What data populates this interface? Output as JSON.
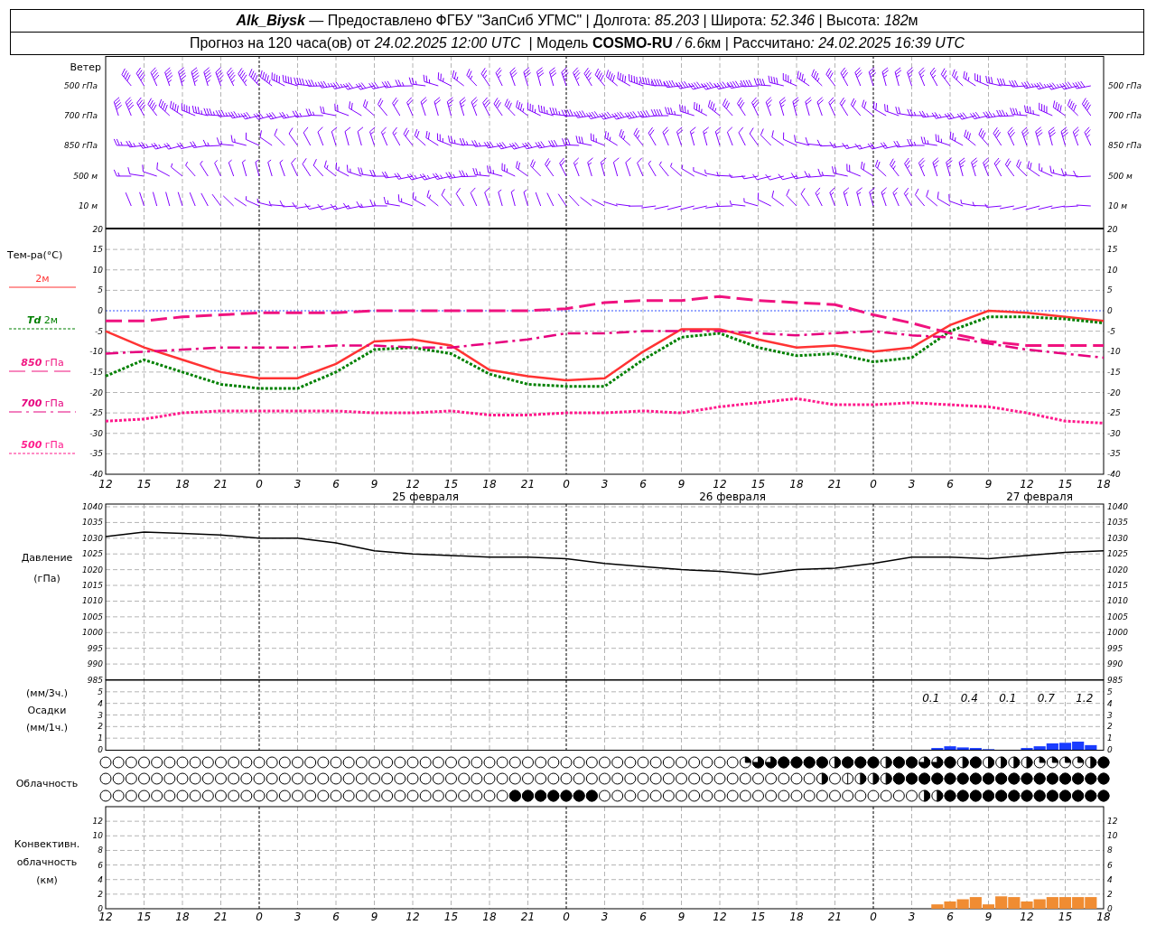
{
  "header": {
    "line1": [
      {
        "text": "Alk_Biysk",
        "kind": "station"
      },
      {
        "text": " — Предоставлено ФГБУ \"ЗапСиб УГМС\" | Долгота: ",
        "kind": "caption"
      },
      {
        "text": "85.203",
        "kind": "value"
      },
      {
        "text": " | Широта: ",
        "kind": "caption"
      },
      {
        "text": "52.346",
        "kind": "value"
      },
      {
        "text": " | Высота: ",
        "kind": "caption"
      },
      {
        "text": "182",
        "kind": "value"
      },
      {
        "text": "м",
        "kind": "caption"
      }
    ],
    "line2": [
      {
        "text": "Прогноз на 120 часа(ов) от ",
        "kind": "caption"
      },
      {
        "text": "24.02.2025 12:00 UTC",
        "kind": "value"
      },
      {
        "text": "  | Модель ",
        "kind": "caption"
      },
      {
        "text": "COSMO-RU",
        "kind": "model"
      },
      {
        "text": " / 6.6",
        "kind": "value"
      },
      {
        "text": "км | Рассчитано",
        "kind": "caption"
      },
      {
        "text": ": 24.02.2025 16:39 UTC",
        "kind": "value"
      }
    ]
  },
  "wind": {
    "title": "Ветер",
    "labels_left": [
      "500 гПа",
      "700 гПа",
      "850 гПа",
      "500 м",
      "10 м"
    ],
    "labels_right": [
      "500 гПа",
      "700 гПа",
      "850 гПа",
      "500 м",
      "10 м"
    ]
  },
  "temperature": {
    "title": "Тем-ра(°C)",
    "dates": [
      "25 февраля",
      "26 февраля",
      "27 февраля"
    ],
    "right_ticks": [
      "20",
      "15",
      "10",
      "5",
      "0",
      "-5",
      "-10",
      "-15",
      "-20",
      "-25",
      "-30",
      "-35",
      "-40"
    ],
    "chart_data": {
      "type": "line",
      "grid": true,
      "categories": [
        "12",
        "15",
        "18",
        "21",
        "0",
        "3",
        "6",
        "9",
        "12",
        "15",
        "18",
        "21",
        "0",
        "3",
        "6",
        "9",
        "12",
        "15",
        "18",
        "21",
        "0",
        "3",
        "6",
        "9",
        "12",
        "15",
        "18"
      ],
      "ylim": [
        -40,
        20
      ],
      "yticks": [
        {
          "value": 20,
          "label": "20"
        },
        {
          "value": 15,
          "label": "15"
        },
        {
          "value": 10,
          "label": "10"
        },
        {
          "value": 5,
          "label": "5"
        },
        {
          "value": 0,
          "label": "0"
        },
        {
          "value": -5,
          "label": "-5"
        },
        {
          "value": -10,
          "label": "-10"
        },
        {
          "value": -15,
          "label": "-15"
        },
        {
          "value": -20,
          "label": "-20"
        },
        {
          "value": -25,
          "label": "-25"
        },
        {
          "value": -30,
          "label": "-30"
        },
        {
          "value": -35,
          "label": "-35"
        },
        {
          "value": -40,
          "label": "-40"
        }
      ],
      "series": [
        {
          "name": "2м",
          "color": "#ff3333",
          "line_style": "solid",
          "values": [
            -5,
            -9,
            -12,
            -15,
            -16.5,
            -16.5,
            -13,
            -7.5,
            -7,
            -8.5,
            -14.5,
            -16,
            -17,
            -16.5,
            -10,
            -4.5,
            -4.5,
            -7,
            -9,
            -8.5,
            -10,
            -9,
            -3.5,
            0,
            -0.5,
            -1.5,
            -2.5
          ]
        },
        {
          "name": "*Td* 2м",
          "color": "#008000",
          "line_style": "dotted",
          "values": [
            -16,
            -12,
            -15,
            -18,
            -19,
            -19,
            -15,
            -9.5,
            -9,
            -10.5,
            -15.5,
            -18,
            -18.5,
            -18.5,
            -12,
            -6.5,
            -5.5,
            -9,
            -11,
            -10.5,
            -12.5,
            -11.5,
            -5,
            -1.5,
            -1.5,
            -2,
            -3
          ]
        },
        {
          "name": "*850* гПа",
          "color": "#f0127f",
          "line_style": "dashed",
          "values": [
            -2.5,
            -2.5,
            -1.5,
            -1,
            -0.5,
            -0.5,
            -0.5,
            0,
            0,
            0,
            0,
            0,
            0.5,
            2,
            2.5,
            2.5,
            3.5,
            2.5,
            2,
            1.5,
            -1,
            -3,
            -5.5,
            -7.5,
            -8.5,
            -8.5,
            -8.5
          ]
        },
        {
          "name": "*700* гПа",
          "color": "#e6007e",
          "line_style": "dashdot",
          "values": [
            -10.5,
            -10,
            -9.5,
            -9,
            -9,
            -9,
            -8.5,
            -8.5,
            -9,
            -9,
            -8,
            -7,
            -5.5,
            -5.5,
            -5,
            -5,
            -5,
            -5.5,
            -6,
            -5.5,
            -5,
            -6,
            -6.5,
            -8,
            -9.5,
            -10.5,
            -11.5
          ]
        },
        {
          "name": "*500* гПа",
          "color": "#ff1a8c",
          "line_style": "dotted",
          "values": [
            -27,
            -26.5,
            -25,
            -24.5,
            -24.5,
            -24.5,
            -24.5,
            -25,
            -25,
            -24.5,
            -25.5,
            -25.5,
            -25,
            -25,
            -24.5,
            -25,
            -23.5,
            -22.5,
            -21.5,
            -23,
            -23,
            -22.5,
            -23,
            -23.5,
            -25,
            -27,
            -27.5
          ]
        }
      ],
      "ref_lines": [
        {
          "axis": "y",
          "value": 0,
          "color": "#3050ff"
        }
      ]
    }
  },
  "pressure": {
    "labels": [
      "Давление",
      "(гПа)"
    ],
    "right_ticks": [
      "1040",
      "1035",
      "1030",
      "1025",
      "1020",
      "1015",
      "1010",
      "1005",
      "1000",
      "995",
      "990",
      "985"
    ],
    "chart_data": {
      "type": "line",
      "grid": true,
      "categories": [
        null,
        null,
        null,
        null,
        null,
        null,
        null,
        null,
        null,
        null,
        null,
        null,
        null,
        null,
        null,
        null,
        null,
        null,
        null,
        null,
        null,
        null,
        null,
        null,
        null,
        null,
        null
      ],
      "ylim": [
        985,
        1040
      ],
      "yticks": [
        {
          "value": 1040,
          "label": "1040"
        },
        {
          "value": 1035,
          "label": "1035"
        },
        {
          "value": 1030,
          "label": "1030"
        },
        {
          "value": 1025,
          "label": "1025"
        },
        {
          "value": 1020,
          "label": "1020"
        },
        {
          "value": 1015,
          "label": "1015"
        },
        {
          "value": 1010,
          "label": "1010"
        },
        {
          "value": 1005,
          "label": "1005"
        },
        {
          "value": 1000,
          "label": "1000"
        },
        {
          "value": 995,
          "label": "995"
        },
        {
          "value": 990,
          "label": "990"
        },
        {
          "value": 985,
          "label": "985"
        }
      ],
      "series": [
        {
          "color": "#000000",
          "values": [
            1030.5,
            1032,
            1031.5,
            1031,
            1030,
            1030,
            1028.5,
            1026,
            1025,
            1024.5,
            1024,
            1024,
            1023.5,
            1022,
            1021,
            1020,
            1019.5,
            1018.5,
            1020,
            1020.5,
            1022,
            1024,
            1024,
            1023.5,
            1024.5,
            1025.5,
            1026
          ]
        }
      ]
    }
  },
  "precipitation": {
    "labels": [
      "(мм/3ч.)",
      "Осадки",
      "(мм/1ч.)"
    ],
    "totals": [
      "0.1",
      "0.4",
      "0.1",
      "0.7",
      "1.2"
    ],
    "right_ticks": [
      "5",
      "4",
      "3",
      "2",
      "1",
      "0"
    ],
    "chart_data": {
      "type": "bar",
      "grid": true,
      "categories": [
        null,
        null,
        null,
        null,
        null,
        null,
        null,
        null,
        null,
        null,
        null,
        null,
        null,
        null,
        null,
        null,
        null,
        null,
        null,
        null,
        null,
        null,
        null,
        null,
        null,
        null,
        null,
        null,
        null,
        null,
        null,
        null,
        null,
        null,
        null,
        null,
        null,
        null,
        null,
        null,
        null,
        null,
        null,
        null,
        null,
        null,
        null,
        null,
        null,
        null,
        null,
        null,
        null,
        null,
        null,
        null,
        null,
        null,
        null,
        null,
        null,
        null,
        null,
        null,
        null,
        null,
        null,
        null,
        null,
        null,
        null,
        null,
        null,
        null,
        null,
        null,
        null,
        null,
        null
      ],
      "series": [
        {
          "color": "#1a3cff",
          "values": [
            null,
            null,
            null,
            null,
            null,
            null,
            null,
            null,
            null,
            null,
            null,
            null,
            null,
            null,
            null,
            null,
            null,
            null,
            null,
            null,
            null,
            null,
            null,
            null,
            null,
            null,
            null,
            null,
            null,
            null,
            null,
            null,
            null,
            null,
            null,
            null,
            null,
            null,
            null,
            null,
            null,
            null,
            null,
            null,
            null,
            null,
            null,
            null,
            null,
            null,
            null,
            null,
            null,
            null,
            null,
            null,
            null,
            null,
            null,
            null,
            null,
            null,
            null,
            null,
            null,
            0.15,
            0.3,
            0.2,
            0.15,
            0.05,
            0,
            0,
            0.15,
            0.3,
            0.55,
            0.6,
            0.7,
            0.4,
            null
          ]
        }
      ],
      "ylim": [
        0,
        6
      ],
      "yticks": [
        {
          "value": 5,
          "label": "5"
        },
        {
          "value": 4,
          "label": "4"
        },
        {
          "value": 3,
          "label": "3"
        },
        {
          "value": 2,
          "label": "2"
        },
        {
          "value": 1,
          "label": "1"
        },
        {
          "value": 0,
          "label": "0"
        }
      ]
    }
  },
  "clouds": {
    "label": "Облачность",
    "rows": [
      {
        "circles": [
          {
            "kind": "clear"
          },
          {
            "kind": "clear"
          },
          {
            "kind": "clear"
          },
          {
            "kind": "clear"
          },
          {
            "kind": "clear"
          },
          {
            "kind": "clear"
          },
          {
            "kind": "clear"
          },
          {
            "kind": "clear"
          },
          {
            "kind": "clear"
          },
          {
            "kind": "clear"
          },
          {
            "kind": "clear"
          },
          {
            "kind": "clear"
          },
          {
            "kind": "clear"
          },
          {
            "kind": "clear"
          },
          {
            "kind": "clear"
          },
          {
            "kind": "clear"
          },
          {
            "kind": "clear"
          },
          {
            "kind": "clear"
          },
          {
            "kind": "clear"
          },
          {
            "kind": "clear"
          },
          {
            "kind": "clear"
          },
          {
            "kind": "clear"
          },
          {
            "kind": "clear"
          },
          {
            "kind": "clear"
          },
          {
            "kind": "clear"
          },
          {
            "kind": "clear"
          },
          {
            "kind": "clear"
          },
          {
            "kind": "clear"
          },
          {
            "kind": "clear"
          },
          {
            "kind": "clear"
          },
          {
            "kind": "clear"
          },
          {
            "kind": "clear"
          },
          {
            "kind": "clear"
          },
          {
            "kind": "clear"
          },
          {
            "kind": "clear"
          },
          {
            "kind": "clear"
          },
          {
            "kind": "clear"
          },
          {
            "kind": "clear"
          },
          {
            "kind": "clear"
          },
          {
            "kind": "clear"
          },
          {
            "kind": "clear"
          },
          {
            "kind": "clear"
          },
          {
            "kind": "clear"
          },
          {
            "kind": "clear"
          },
          {
            "kind": "clear"
          },
          {
            "kind": "clear"
          },
          {
            "kind": "clear"
          },
          {
            "kind": "clear"
          },
          {
            "kind": "clear"
          },
          {
            "kind": "clear"
          },
          {
            "kind": "quarter"
          },
          {
            "kind": "three_quarters"
          },
          {
            "kind": "three_quarters"
          },
          {
            "kind": "overcast"
          },
          {
            "kind": "overcast"
          },
          {
            "kind": "overcast"
          },
          {
            "kind": "overcast"
          },
          {
            "kind": "half"
          },
          {
            "kind": "overcast"
          },
          {
            "kind": "overcast"
          },
          {
            "kind": "overcast"
          },
          {
            "kind": "half"
          },
          {
            "kind": "overcast"
          },
          {
            "kind": "overcast"
          },
          {
            "kind": "three_quarters"
          },
          {
            "kind": "three_quarters"
          },
          {
            "kind": "overcast"
          },
          {
            "kind": "half"
          },
          {
            "kind": "overcast"
          },
          {
            "kind": "half"
          },
          {
            "kind": "half"
          },
          {
            "kind": "half"
          },
          {
            "kind": "half"
          },
          {
            "kind": "quarter"
          },
          {
            "kind": "quarter"
          },
          {
            "kind": "quarter"
          },
          {
            "kind": "quarter"
          },
          {
            "kind": "half"
          },
          {
            "kind": "overcast"
          }
        ]
      },
      {
        "circles": [
          {
            "kind": "clear"
          },
          {
            "kind": "clear"
          },
          {
            "kind": "clear"
          },
          {
            "kind": "clear"
          },
          {
            "kind": "clear"
          },
          {
            "kind": "clear"
          },
          {
            "kind": "clear"
          },
          {
            "kind": "clear"
          },
          {
            "kind": "clear"
          },
          {
            "kind": "clear"
          },
          {
            "kind": "clear"
          },
          {
            "kind": "clear"
          },
          {
            "kind": "clear"
          },
          {
            "kind": "clear"
          },
          {
            "kind": "clear"
          },
          {
            "kind": "clear"
          },
          {
            "kind": "clear"
          },
          {
            "kind": "clear"
          },
          {
            "kind": "clear"
          },
          {
            "kind": "clear"
          },
          {
            "kind": "clear"
          },
          {
            "kind": "clear"
          },
          {
            "kind": "clear"
          },
          {
            "kind": "clear"
          },
          {
            "kind": "clear"
          },
          {
            "kind": "clear"
          },
          {
            "kind": "clear"
          },
          {
            "kind": "clear"
          },
          {
            "kind": "clear"
          },
          {
            "kind": "clear"
          },
          {
            "kind": "clear"
          },
          {
            "kind": "clear"
          },
          {
            "kind": "clear"
          },
          {
            "kind": "clear"
          },
          {
            "kind": "clear"
          },
          {
            "kind": "clear"
          },
          {
            "kind": "clear"
          },
          {
            "kind": "clear"
          },
          {
            "kind": "clear"
          },
          {
            "kind": "clear"
          },
          {
            "kind": "clear"
          },
          {
            "kind": "clear"
          },
          {
            "kind": "clear"
          },
          {
            "kind": "clear"
          },
          {
            "kind": "clear"
          },
          {
            "kind": "clear"
          },
          {
            "kind": "clear"
          },
          {
            "kind": "clear"
          },
          {
            "kind": "clear"
          },
          {
            "kind": "clear"
          },
          {
            "kind": "clear"
          },
          {
            "kind": "clear"
          },
          {
            "kind": "clear"
          },
          {
            "kind": "clear"
          },
          {
            "kind": "clear"
          },
          {
            "kind": "clear"
          },
          {
            "kind": "half"
          },
          {
            "kind": "clear"
          },
          {
            "kind": "eighth"
          },
          {
            "kind": "half"
          },
          {
            "kind": "half"
          },
          {
            "kind": "half"
          },
          {
            "kind": "overcast"
          },
          {
            "kind": "overcast"
          },
          {
            "kind": "overcast"
          },
          {
            "kind": "overcast"
          },
          {
            "kind": "overcast"
          },
          {
            "kind": "overcast"
          },
          {
            "kind": "overcast"
          },
          {
            "kind": "overcast"
          },
          {
            "kind": "overcast"
          },
          {
            "kind": "overcast"
          },
          {
            "kind": "overcast"
          },
          {
            "kind": "overcast"
          },
          {
            "kind": "overcast"
          },
          {
            "kind": "overcast"
          },
          {
            "kind": "overcast"
          },
          {
            "kind": "overcast"
          },
          {
            "kind": "overcast"
          }
        ]
      },
      {
        "circles": [
          {
            "kind": "clear"
          },
          {
            "kind": "clear"
          },
          {
            "kind": "clear"
          },
          {
            "kind": "clear"
          },
          {
            "kind": "clear"
          },
          {
            "kind": "clear"
          },
          {
            "kind": "clear"
          },
          {
            "kind": "clear"
          },
          {
            "kind": "clear"
          },
          {
            "kind": "clear"
          },
          {
            "kind": "clear"
          },
          {
            "kind": "clear"
          },
          {
            "kind": "clear"
          },
          {
            "kind": "clear"
          },
          {
            "kind": "clear"
          },
          {
            "kind": "clear"
          },
          {
            "kind": "clear"
          },
          {
            "kind": "clear"
          },
          {
            "kind": "clear"
          },
          {
            "kind": "clear"
          },
          {
            "kind": "clear"
          },
          {
            "kind": "clear"
          },
          {
            "kind": "clear"
          },
          {
            "kind": "clear"
          },
          {
            "kind": "clear"
          },
          {
            "kind": "clear"
          },
          {
            "kind": "clear"
          },
          {
            "kind": "clear"
          },
          {
            "kind": "clear"
          },
          {
            "kind": "clear"
          },
          {
            "kind": "clear"
          },
          {
            "kind": "clear"
          },
          {
            "kind": "overcast"
          },
          {
            "kind": "overcast"
          },
          {
            "kind": "overcast"
          },
          {
            "kind": "overcast"
          },
          {
            "kind": "overcast"
          },
          {
            "kind": "overcast"
          },
          {
            "kind": "overcast"
          },
          {
            "kind": "clear"
          },
          {
            "kind": "clear"
          },
          {
            "kind": "clear"
          },
          {
            "kind": "clear"
          },
          {
            "kind": "clear"
          },
          {
            "kind": "clear"
          },
          {
            "kind": "clear"
          },
          {
            "kind": "clear"
          },
          {
            "kind": "clear"
          },
          {
            "kind": "clear"
          },
          {
            "kind": "clear"
          },
          {
            "kind": "clear"
          },
          {
            "kind": "clear"
          },
          {
            "kind": "clear"
          },
          {
            "kind": "clear"
          },
          {
            "kind": "clear"
          },
          {
            "kind": "clear"
          },
          {
            "kind": "clear"
          },
          {
            "kind": "clear"
          },
          {
            "kind": "clear"
          },
          {
            "kind": "clear"
          },
          {
            "kind": "clear"
          },
          {
            "kind": "clear"
          },
          {
            "kind": "clear"
          },
          {
            "kind": "clear"
          },
          {
            "kind": "half"
          },
          {
            "kind": "half"
          },
          {
            "kind": "overcast"
          },
          {
            "kind": "overcast"
          },
          {
            "kind": "overcast"
          },
          {
            "kind": "overcast"
          },
          {
            "kind": "overcast"
          },
          {
            "kind": "overcast"
          },
          {
            "kind": "overcast"
          },
          {
            "kind": "overcast"
          },
          {
            "kind": "overcast"
          },
          {
            "kind": "overcast"
          },
          {
            "kind": "overcast"
          },
          {
            "kind": "overcast"
          },
          {
            "kind": "overcast"
          }
        ]
      }
    ]
  },
  "convective": {
    "labels": [
      "Конвективн.",
      "облачность",
      "(км)"
    ],
    "right_ticks": [
      "12",
      "10",
      "8",
      "6",
      "4",
      "2",
      "0"
    ],
    "chart_data": {
      "type": "bar",
      "grid": true,
      "categories": [
        "12",
        null,
        null,
        "15",
        null,
        null,
        "18",
        null,
        null,
        "21",
        null,
        null,
        "0",
        null,
        null,
        "3",
        null,
        null,
        "6",
        null,
        null,
        "9",
        null,
        null,
        "12",
        null,
        null,
        "15",
        null,
        null,
        "18",
        null,
        null,
        "21",
        null,
        null,
        "0",
        null,
        null,
        "3",
        null,
        null,
        "6",
        null,
        null,
        "9",
        null,
        null,
        "12",
        null,
        null,
        "15",
        null,
        null,
        "18",
        null,
        null,
        "21",
        null,
        null,
        "0",
        null,
        null,
        "3",
        null,
        null,
        "6",
        null,
        null,
        "9",
        null,
        null,
        "12",
        null,
        null,
        "15",
        null,
        null,
        "18"
      ],
      "series": [
        {
          "color": "#f08c32",
          "values": [
            null,
            null,
            null,
            null,
            null,
            null,
            null,
            null,
            null,
            null,
            null,
            null,
            null,
            null,
            null,
            null,
            null,
            null,
            null,
            null,
            null,
            null,
            null,
            null,
            null,
            null,
            null,
            null,
            null,
            null,
            null,
            null,
            null,
            null,
            null,
            null,
            null,
            null,
            null,
            null,
            null,
            null,
            null,
            null,
            null,
            null,
            null,
            null,
            null,
            null,
            null,
            null,
            null,
            null,
            null,
            null,
            null,
            null,
            null,
            null,
            null,
            null,
            null,
            null,
            null,
            0.6,
            1.0,
            1.3,
            1.6,
            0.6,
            1.7,
            1.6,
            1.0,
            1.3,
            1.6,
            1.6,
            1.6,
            1.6,
            null
          ]
        }
      ],
      "ylim": [
        0,
        14
      ],
      "yticks": [
        {
          "value": 12,
          "label": "12"
        },
        {
          "value": 10,
          "label": "10"
        },
        {
          "value": 8,
          "label": "8"
        },
        {
          "value": 6,
          "label": "6"
        },
        {
          "value": 4,
          "label": "4"
        },
        {
          "value": 2,
          "label": "2"
        },
        {
          "value": 0,
          "label": "0"
        }
      ]
    }
  }
}
